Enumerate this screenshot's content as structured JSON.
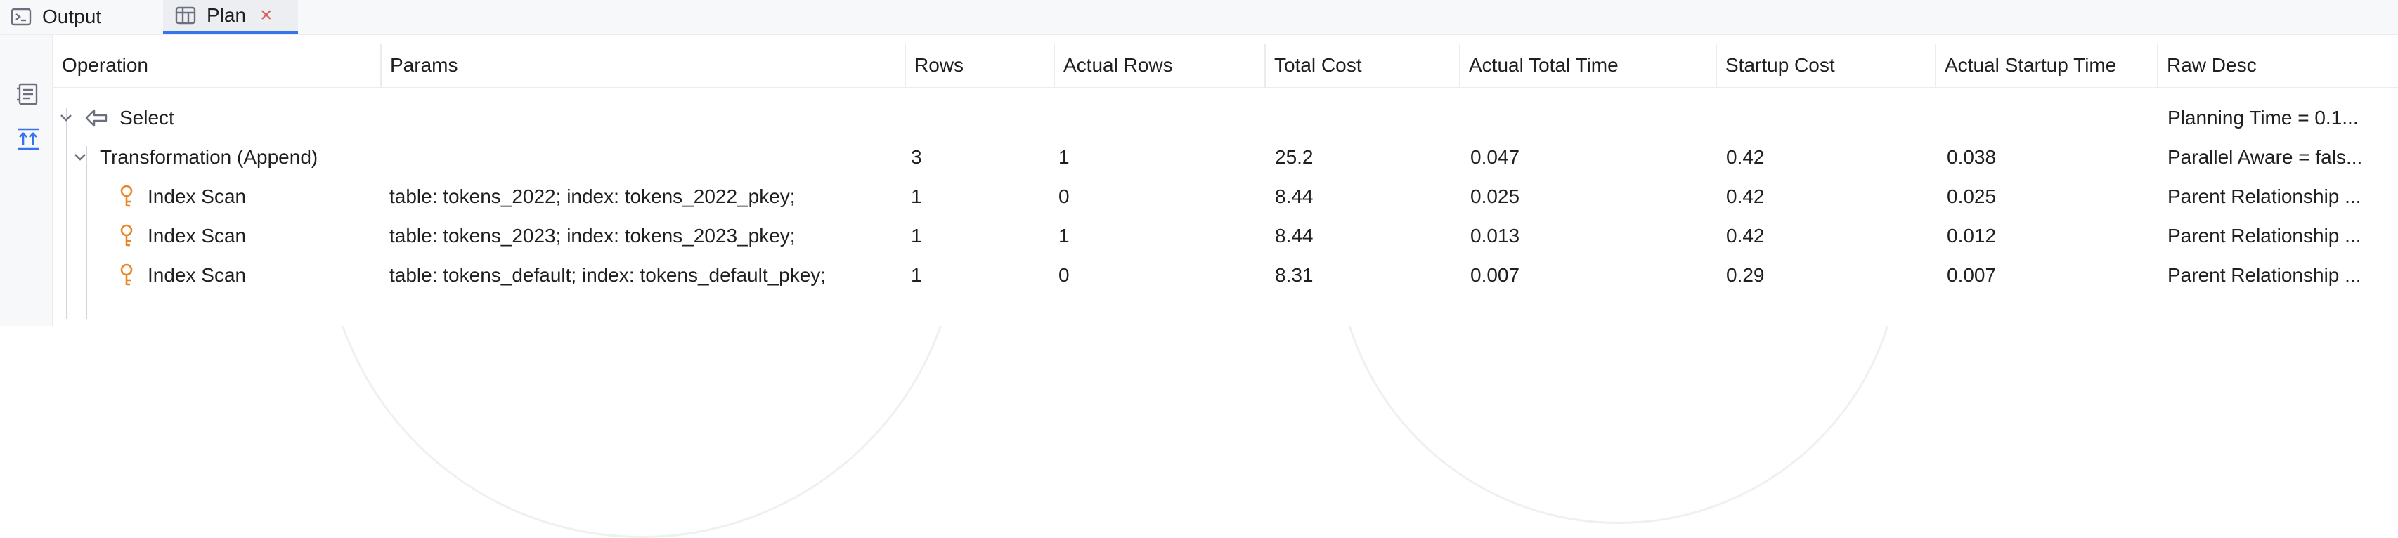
{
  "tabs": {
    "output_label": "Output",
    "plan_label": "Plan",
    "close_glyph": "×"
  },
  "columns": [
    "Operation",
    "Params",
    "Rows",
    "Actual Rows",
    "Total Cost",
    "Actual Total Time",
    "Startup Cost",
    "Actual Startup Time",
    "Raw Desc"
  ],
  "rows": [
    {
      "operation": "Select",
      "params": "",
      "rows": "",
      "actual_rows": "",
      "total_cost": "",
      "actual_total_time": "",
      "startup_cost": "",
      "actual_startup_time": "",
      "raw_desc": "Planning Time = 0.1..."
    },
    {
      "operation": "Transformation (Append)",
      "params": "",
      "rows": "3",
      "actual_rows": "1",
      "total_cost": "25.2",
      "actual_total_time": "0.047",
      "startup_cost": "0.42",
      "actual_startup_time": "0.038",
      "raw_desc": "Parallel Aware = fals..."
    },
    {
      "operation": "Index Scan",
      "params": "table: tokens_2022; index: tokens_2022_pkey;",
      "rows": "1",
      "actual_rows": "0",
      "total_cost": "8.44",
      "actual_total_time": "0.025",
      "startup_cost": "0.42",
      "actual_startup_time": "0.025",
      "raw_desc": "Parent Relationship ..."
    },
    {
      "operation": "Index Scan",
      "params": "table: tokens_2023; index: tokens_2023_pkey;",
      "rows": "1",
      "actual_rows": "1",
      "total_cost": "8.44",
      "actual_total_time": "0.013",
      "startup_cost": "0.42",
      "actual_startup_time": "0.012",
      "raw_desc": "Parent Relationship ..."
    },
    {
      "operation": "Index Scan",
      "params": "table: tokens_default; index: tokens_default_pkey;",
      "rows": "1",
      "actual_rows": "0",
      "total_cost": "8.31",
      "actual_total_time": "0.007",
      "startup_cost": "0.29",
      "actual_startup_time": "0.007",
      "raw_desc": "Parent Relationship ..."
    }
  ],
  "icons": {
    "output": "console-icon",
    "plan": "table-icon",
    "left_toolbar_1": "explain-plan-icon",
    "left_toolbar_2": "expand-all-icon",
    "select": "select-arrow-icon",
    "index_scan": "key-icon",
    "tree_toggle": "chevron-down-icon"
  },
  "colors": {
    "accent": "#3574f0",
    "close": "#db5c5c",
    "key_icon": "#e8872c"
  }
}
